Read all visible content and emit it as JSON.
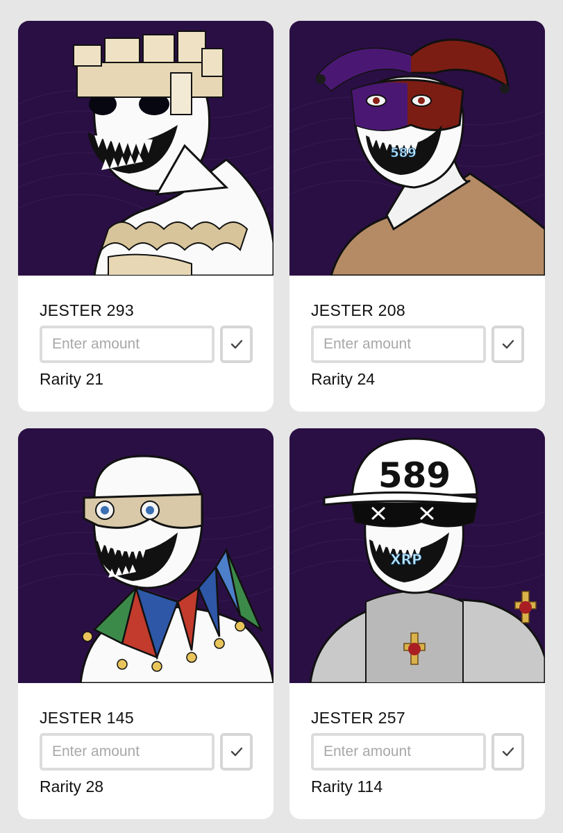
{
  "placeholder": "Enter amount",
  "accent": {
    "art_background": "#2a0f44",
    "border": "#dcdcdc"
  },
  "cards": [
    {
      "name": "JESTER 293",
      "rarity": "Rarity 21",
      "theme": "scroll-crown-skull"
    },
    {
      "name": "JESTER 208",
      "rarity": "Rarity 24",
      "theme": "jester-hat-mask"
    },
    {
      "name": "JESTER 145",
      "rarity": "Rarity 28",
      "theme": "ornate-glasses-collar"
    },
    {
      "name": "JESTER 257",
      "rarity": "Rarity 114",
      "theme": "cap-visor-armor",
      "cap_text": "589",
      "teeth_text": "XRP"
    }
  ],
  "extra": {
    "mask_teeth_text": "589"
  },
  "icons": {
    "confirm": "check-icon"
  }
}
